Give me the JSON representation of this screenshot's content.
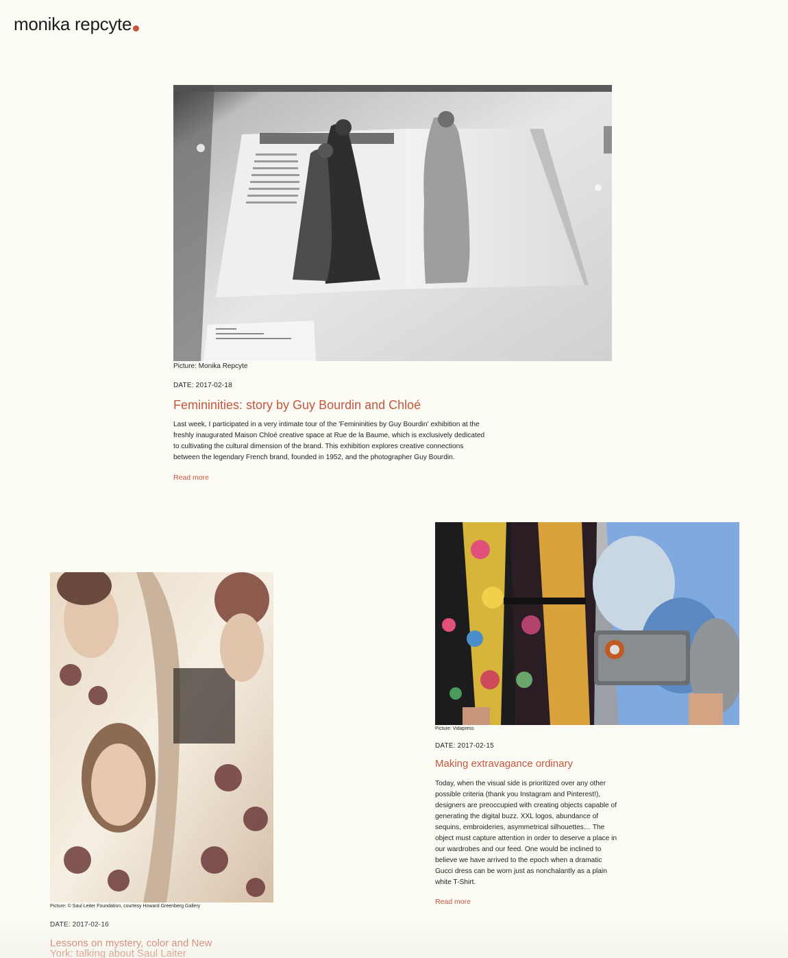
{
  "site": {
    "name": "monika repcyte",
    "accent_color": "#c4553f",
    "background_color": "#fcfcf4"
  },
  "posts": [
    {
      "caption": "Picture: Monika Repcyte",
      "date": "DATE: 2017-02-18",
      "title": "Femininities: story by Guy Bourdin and Chloé",
      "excerpt": "Last week, I participated in a very intimate tour of the 'Femininities by Guy Bourdin' exhibition at the freshly inaugurated Maison Chloé creative space at Rue de la Baume, which is exclusively dedicated to cultivating the cultural dimension of the brand. This exhibition explores creative connections between the legendary French brand, founded in 1952, and the photographer Guy Bourdin.",
      "read_more": "Read more"
    },
    {
      "caption": "Picture: Vidapress",
      "date": "DATE: 2017-02-15",
      "title": "Making extravagance ordinary",
      "excerpt": "Today, when the visual side is prioritized over any other possible criteria (thank you Instagram and Pinterest!), designers are preoccupied with creating objects capable of generating the digital buzz. XXL logos, abundance of sequins, embroideries, asymmetrical silhouettes… The object must capture attention in order to deserve a place in our wardrobes and our feed. One would be inclined to believe we have arrived to the epoch when a dramatic Gucci dress can be worn just as nonchalantly as a plain white T-Shirt.",
      "read_more": "Read more"
    },
    {
      "caption": "Picture: © Saul Leiter Foundation, courtesy Howard Greenberg Gallery",
      "date": "DATE: 2017-02-16",
      "title": "Lessons on mystery, color and New York: talking about Saul Laiter"
    }
  ]
}
